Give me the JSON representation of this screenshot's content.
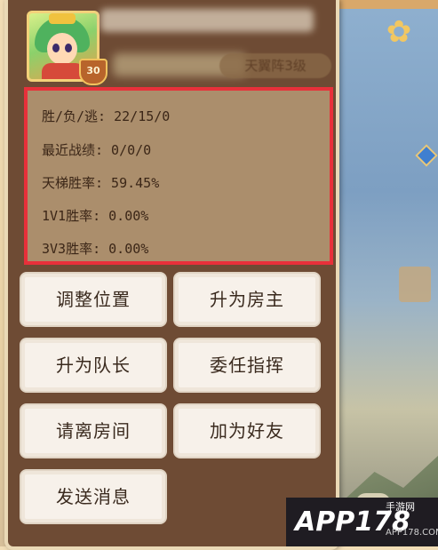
{
  "avatar": {
    "level": "30"
  },
  "header": {
    "rank_text": "天翼阵3级"
  },
  "stats": {
    "win_loss_flee": "胜/负/逃: 22/15/0",
    "recent_record": "最近战绩: 0/0/0",
    "ladder_win_rate": "天梯胜率: 59.45%",
    "win_rate_1v1": "1V1胜率: 0.00%",
    "win_rate_3v3": "3V3胜率: 0.00%",
    "highlight_color": "#e8303a"
  },
  "actions": {
    "adjust_position": "调整位置",
    "promote_host": "升为房主",
    "promote_captain": "升为队长",
    "appoint_commander": "委任指挥",
    "kick_from_room": "请离房间",
    "add_friend": "加为好友",
    "send_message": "发送消息"
  },
  "watermark": {
    "brand": "APP178",
    "site": "手游网",
    "url": "APP178.COM"
  }
}
